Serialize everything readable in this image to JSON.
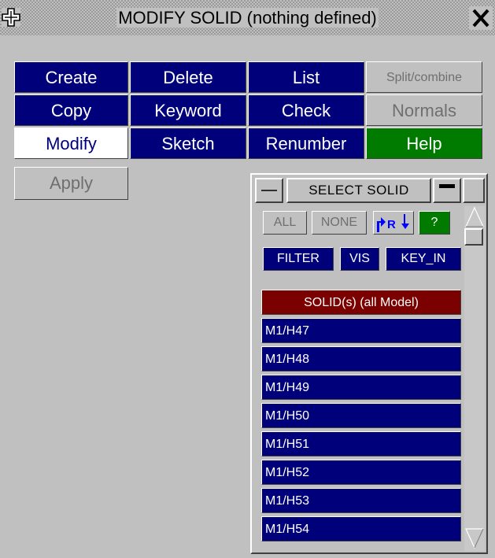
{
  "window": {
    "title": "MODIFY SOLID (nothing defined)",
    "move_icon": "move-cross-icon",
    "close_icon": "close-x-icon"
  },
  "actions": {
    "create": "Create",
    "delete": "Delete",
    "list": "List",
    "split_combine": "Split/combine",
    "copy": "Copy",
    "keyword": "Keyword",
    "check": "Check",
    "normals": "Normals",
    "modify": "Modify",
    "sketch": "Sketch",
    "renumber": "Renumber",
    "help": "Help",
    "apply": "Apply"
  },
  "select_panel": {
    "title": "SELECT SOLID",
    "all": "ALL",
    "none": "NONE",
    "reverse_icon": "reverse-selection-icon",
    "reverse_label": "R",
    "question": "?",
    "filter": "FILTER",
    "vis": "VIS",
    "key_in": "KEY_IN",
    "list_header": "SOLID(s) (all Model)",
    "items": [
      "M1/H47",
      "M1/H48",
      "M1/H49",
      "M1/H50",
      "M1/H51",
      "M1/H52",
      "M1/H53",
      "M1/H54"
    ]
  },
  "colors": {
    "navy": "#00007b",
    "green": "#007b00",
    "maroon": "#7b0000",
    "panel_grey": "#c0c0c0"
  }
}
